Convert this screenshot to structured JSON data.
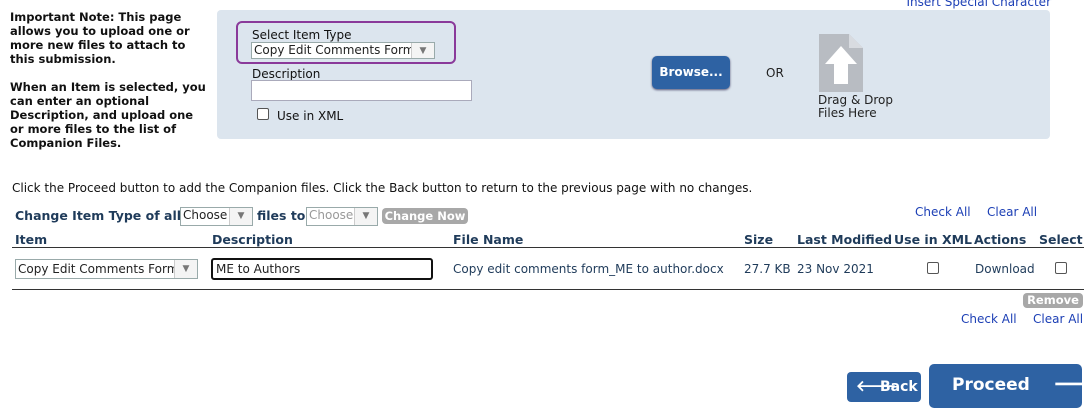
{
  "note": {
    "line1": "Important Note: This page allows you to upload one or more new files to attach to this submission.",
    "line2": "When an Item is selected, you can enter an optional Description, and upload one or more files to the list of Companion Files."
  },
  "insert_special": "Insert Special Character",
  "upload": {
    "select_label": "Select Item Type",
    "select_value": "Copy Edit Comments Form",
    "description_label": "Description",
    "description_value": "",
    "use_in_xml_label": "Use in XML",
    "browse_label": "Browse...",
    "or_label": "OR",
    "drag_drop_line1": "Drag & Drop",
    "drag_drop_line2": "Files Here"
  },
  "instructions": "Click the Proceed button to add the Companion files. Click the Back button to return to the previous page with no changes.",
  "bulk": {
    "prefix": "Change Item Type of all",
    "select1": "Choose",
    "middle": "files to",
    "select2": "Choose",
    "button": "Change Now"
  },
  "check_all": "Check All",
  "clear_all": "Clear All",
  "table": {
    "headers": [
      "Item",
      "Description",
      "File Name",
      "Size",
      "Last Modified",
      "Use in XML",
      "Actions",
      "Select"
    ],
    "rows": [
      {
        "item": "Copy Edit Comments Form",
        "description": "ME to Authors",
        "file_name": "Copy edit comments form_ME to author.docx",
        "size": "27.7 KB",
        "last_modified": "23 Nov 2021",
        "action": "Download"
      }
    ]
  },
  "remove_label": "Remove",
  "back_label": "Back",
  "proceed_label": "Proceed"
}
